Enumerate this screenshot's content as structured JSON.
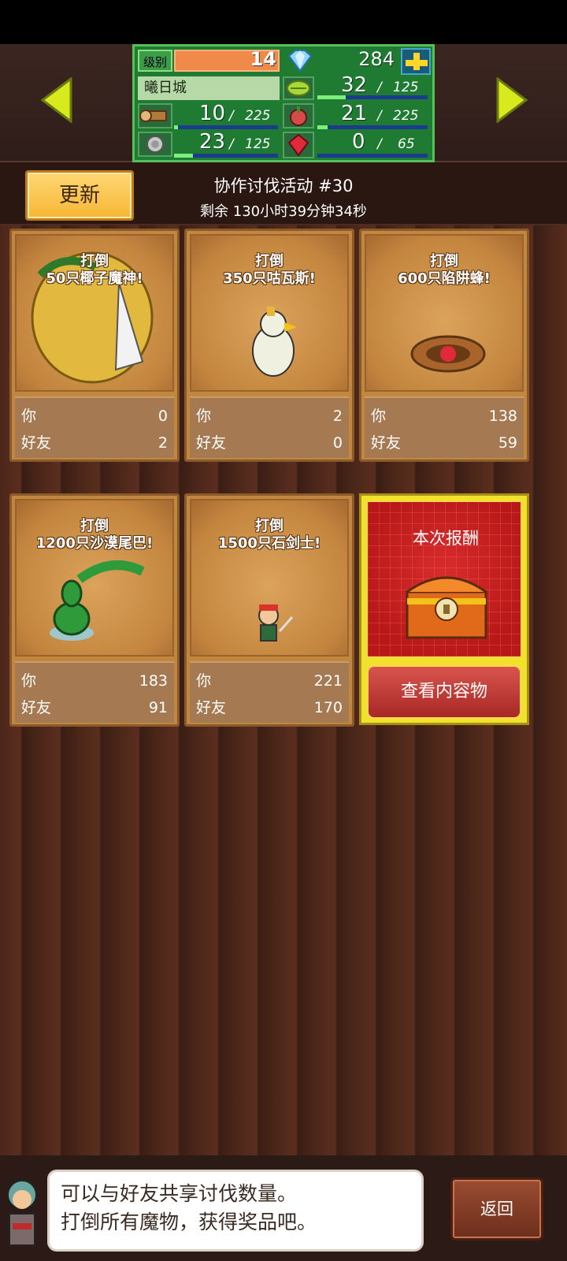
{
  "header": {
    "level_label": "级别",
    "level": "14",
    "gems": "284",
    "town_name": "曦日城",
    "resources": [
      {
        "name": "wood-icon",
        "value": "10",
        "max": "225",
        "progress": 0.044
      },
      {
        "name": "stone-icon",
        "value": "23",
        "max": "125",
        "progress": 0.18
      },
      {
        "name": "grass-icon",
        "value": "32",
        "max": "125",
        "progress": 0.26
      },
      {
        "name": "food-icon",
        "value": "21",
        "max": "225",
        "progress": 0.09
      },
      {
        "name": "ruby-icon",
        "value": "0",
        "max": "65",
        "progress": 0.0
      }
    ]
  },
  "event": {
    "update_button": "更新",
    "title": "协作讨伐活动 #30",
    "time_left": "剩余 130小时39分钟34秒"
  },
  "cards": [
    {
      "line1": "打倒",
      "line2": "50只椰子魔神!",
      "you_label": "你",
      "you": "0",
      "friend_label": "好友",
      "friend": "2",
      "art": "coconut-demon-icon"
    },
    {
      "line1": "打倒",
      "line2": "350只咕瓦斯!",
      "you_label": "你",
      "you": "2",
      "friend_label": "好友",
      "friend": "0",
      "art": "bird-monster-icon"
    },
    {
      "line1": "打倒",
      "line2": "600只陷阱蜂!",
      "you_label": "你",
      "you": "138",
      "friend_label": "好友",
      "friend": "59",
      "art": "trap-bee-icon"
    },
    {
      "line1": "打倒",
      "line2": "1200只沙漠尾巴!",
      "you_label": "你",
      "you": "183",
      "friend_label": "好友",
      "friend": "91",
      "art": "desert-tail-icon"
    },
    {
      "line1": "打倒",
      "line2": "1500只石剑士!",
      "you_label": "你",
      "you": "221",
      "friend_label": "好友",
      "friend": "170",
      "art": "stone-swordsman-icon"
    }
  ],
  "reward": {
    "title": "本次报酬",
    "view_button": "查看内容物"
  },
  "message": {
    "line1": "可以与好友共享讨伐数量。",
    "line2": "打倒所有魔物，获得奖品吧。"
  },
  "back_button": "返回"
}
